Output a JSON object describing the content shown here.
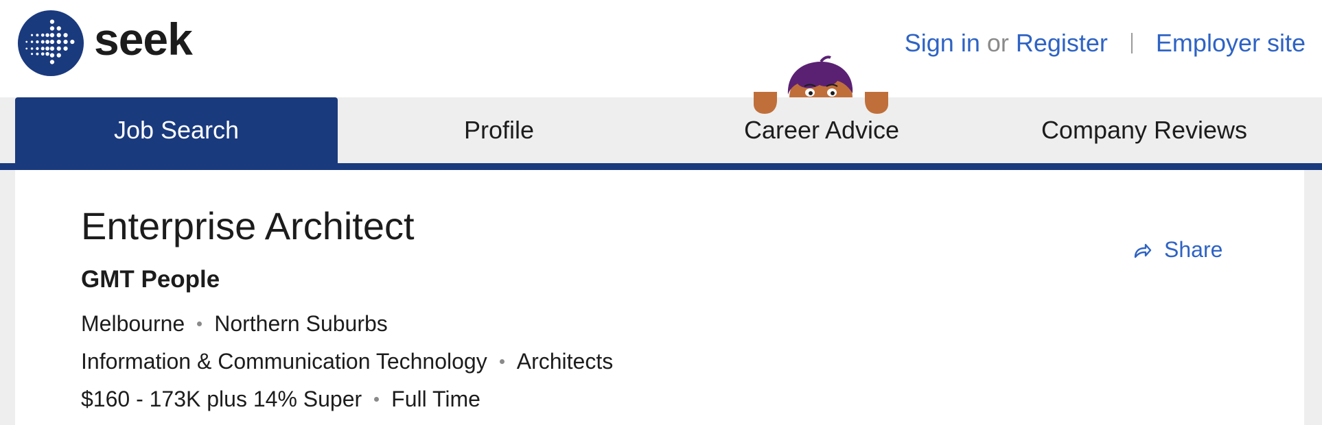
{
  "header": {
    "logo_text": "seek",
    "sign_in": "Sign in",
    "or": "or",
    "register": "Register",
    "employer_site": "Employer site"
  },
  "nav": {
    "tabs": [
      {
        "label": "Job Search",
        "active": true
      },
      {
        "label": "Profile",
        "active": false
      },
      {
        "label": "Career Advice",
        "active": false
      },
      {
        "label": "Company Reviews",
        "active": false
      }
    ]
  },
  "job": {
    "title": "Enterprise Architect",
    "company": "GMT People",
    "location": "Melbourne",
    "area": "Northern Suburbs",
    "classification": "Information & Communication Technology",
    "sub_classification": "Architects",
    "salary": "$160 - 173K plus 14% Super",
    "work_type": "Full Time"
  },
  "actions": {
    "share_label": "Share"
  },
  "colors": {
    "brand_navy": "#1a3a7e",
    "link_blue": "#2e63c4",
    "nav_bg": "#eeeeee"
  },
  "icons": {
    "logo": "seek-logo-icon",
    "share": "share-arrow-icon",
    "mascot": "peeking-mascot-icon"
  }
}
